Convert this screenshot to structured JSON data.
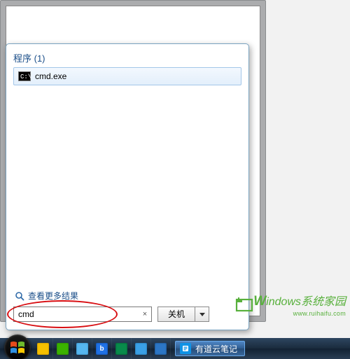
{
  "start_menu": {
    "section_header": "程序 (1)",
    "results": [
      {
        "label": "cmd.exe",
        "icon": "cmd-prompt"
      }
    ],
    "more_results": "查看更多结果",
    "search_value": "cmd",
    "clear_icon": "×",
    "shutdown_label": "关机"
  },
  "taskbar": {
    "active_task": {
      "label": "有道云笔记",
      "icon": "youdao-note"
    }
  },
  "watermark": {
    "line1": "indows系统家园",
    "line1_initial": "W",
    "line2": "www.ruihaifu.com"
  }
}
